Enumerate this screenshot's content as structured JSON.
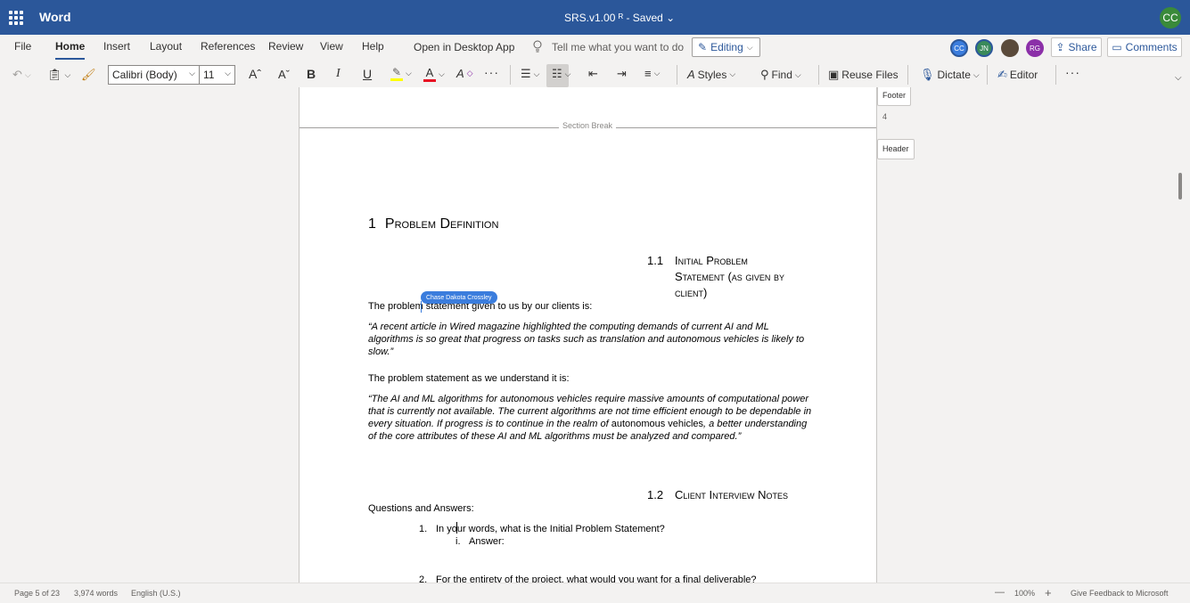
{
  "title_bar": {
    "app_name": "Word",
    "doc_title": "SRS.v1.00 ᴿ - Saved ⌄",
    "user_initials": "CC"
  },
  "menu": {
    "items": [
      "File",
      "Home",
      "Insert",
      "Layout",
      "References",
      "Review",
      "View",
      "Help",
      "Open in Desktop App"
    ],
    "tell_me": "Tell me what you want to do",
    "editing": "Editing",
    "collaborators": [
      "CC",
      "JN",
      "",
      "RG"
    ],
    "share": "Share",
    "comments": "Comments"
  },
  "ribbon": {
    "font_name": "Calibri (Body)",
    "font_size": "11",
    "bold": "B",
    "italic": "I",
    "underline": "U",
    "more": "···",
    "styles": "Styles",
    "find": "Find",
    "reuse_files": "Reuse Files",
    "dictate": "Dictate",
    "editor": "Editor"
  },
  "side": {
    "footer_label": "Footer",
    "page_num": "4",
    "header_label": "Header"
  },
  "doc": {
    "section_break": "Section Break",
    "h1_num": "1",
    "h1_text": "Problem Definition",
    "h2a_num": "1.1",
    "h2a_line1": "Initial Problem",
    "h2a_line2": "Statement (as given by",
    "h2a_line3": "client)",
    "collab_cursor": "Chase Dakota Crossley",
    "p1": "The problem statement given to us by our clients is:",
    "q1": "“A recent article in Wired magazine highlighted the computing demands of current AI and ML algorithms is so great that progress on tasks such as translation and autonomous vehicles is likely to slow.”",
    "p2": "The problem statement as we understand it is:",
    "q2a": "“The AI and ML algorithms for autonomous vehicles require massive amounts of computational power that is currently not available. The current algorithms are not time efficient enough to be dependable in every situation. If progress is to continue in the realm of ",
    "q2b": "autonomous vehicles",
    "q2c": ", a better understanding of the core attributes of these AI and ML algorithms must be analyzed and compared.”",
    "h2b_num": "1.2",
    "h2b_text": "Client Interview Notes",
    "qa_label": "Questions and Answers:",
    "list1_num": "1.",
    "list1": "In your words, what is the Initial Problem Statement?",
    "sub1_num": "i.",
    "sub1": "Answer:",
    "list2_num": "2.",
    "list2": "For the entirety of the project, what would you want for a final deliverable?"
  },
  "status": {
    "page": "Page 5 of 23",
    "words": "3,974 words",
    "language": "English (U.S.)",
    "zoom": "100%",
    "minus": "—",
    "plus": "+",
    "feedback": "Give Feedback to Microsoft"
  },
  "colors": {
    "title_bar": "#2b579a",
    "collab_blue": "#3b7ddd",
    "highlight_yellow": "#ffff00",
    "font_red": "#e81123"
  }
}
